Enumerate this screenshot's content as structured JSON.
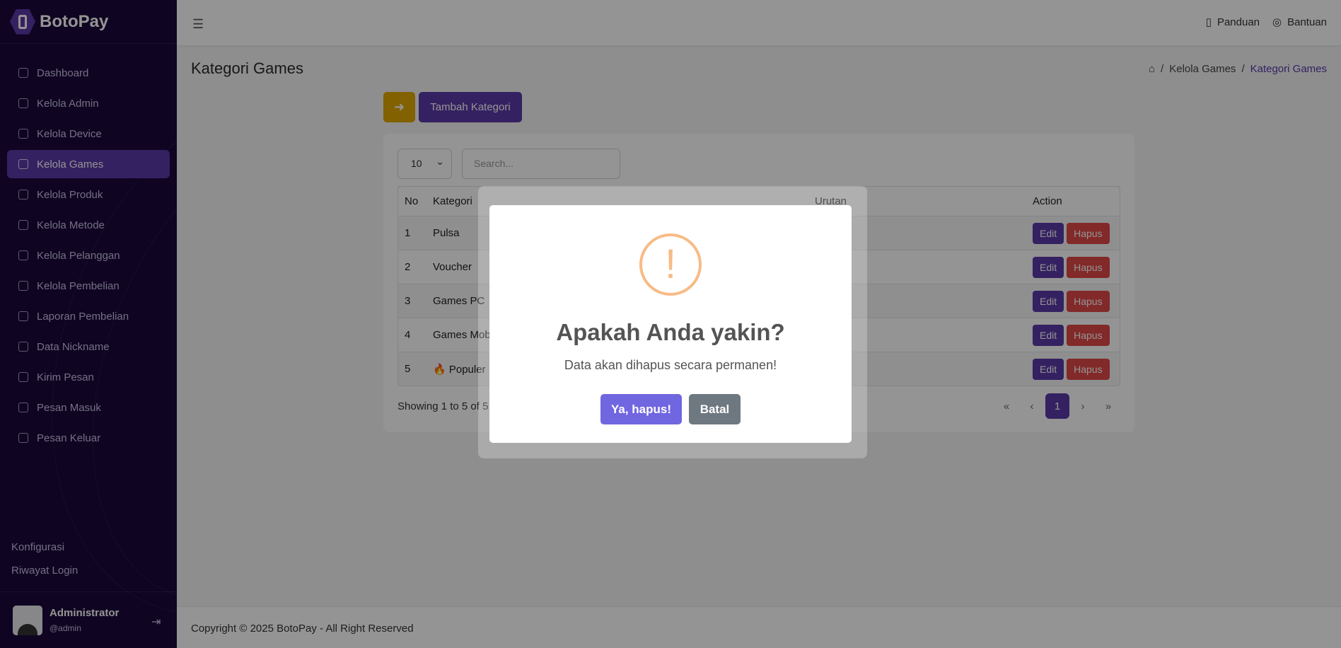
{
  "brand": {
    "name": "BotoPay"
  },
  "sidebar": {
    "items": [
      {
        "label": "Dashboard",
        "icon": "home-icon"
      },
      {
        "label": "Kelola Admin",
        "icon": "user-icon"
      },
      {
        "label": "Kelola Device",
        "icon": "device-icon"
      },
      {
        "label": "Kelola Games",
        "icon": "gamepad-icon"
      },
      {
        "label": "Kelola Produk",
        "icon": "box-icon"
      },
      {
        "label": "Kelola Metode",
        "icon": "card-icon"
      },
      {
        "label": "Kelola Pelanggan",
        "icon": "users-icon"
      },
      {
        "label": "Kelola Pembelian",
        "icon": "cart-icon"
      },
      {
        "label": "Laporan Pembelian",
        "icon": "report-icon"
      },
      {
        "label": "Data Nickname",
        "icon": "id-icon"
      },
      {
        "label": "Kirim Pesan",
        "icon": "send-icon"
      },
      {
        "label": "Pesan Masuk",
        "icon": "inbox-icon"
      },
      {
        "label": "Pesan Keluar",
        "icon": "outbox-icon"
      }
    ],
    "bottom": {
      "config": "Konfigurasi",
      "login_history": "Riwayat Login"
    },
    "user": {
      "name": "Administrator",
      "handle": "@admin"
    }
  },
  "topbar": {
    "guide": "Panduan",
    "help": "Bantuan"
  },
  "page": {
    "title": "Kategori Games",
    "breadcrumb": [
      "Kelola Games",
      "Kategori Games"
    ],
    "add_button": "Tambah Kategori"
  },
  "table": {
    "page_size": "10",
    "search_placeholder": "Search...",
    "headers": {
      "no": "No",
      "kategori": "Kategori",
      "urutan": "Urutan",
      "action": "Action"
    },
    "rows": [
      {
        "no": "1",
        "kategori": "Pulsa"
      },
      {
        "no": "2",
        "kategori": "Voucher"
      },
      {
        "no": "3",
        "kategori": "Games PC"
      },
      {
        "no": "4",
        "kategori": "Games Mobile"
      },
      {
        "no": "5",
        "kategori": "🔥 Populer"
      }
    ],
    "edit_label": "Edit",
    "delete_label": "Hapus",
    "showing": "Showing 1 to 5 of 5 entries",
    "pager": {
      "first": "«",
      "prev": "‹",
      "current": "1",
      "next": "›",
      "last": "»"
    }
  },
  "footer": {
    "copyright": "Copyright © 2025 BotoPay - All Right Reserved"
  },
  "modal": {
    "icon": "!",
    "title": "Apakah Anda yakin?",
    "text": "Data akan dihapus secara permanen!",
    "confirm": "Ya, hapus!",
    "cancel": "Batal"
  },
  "colors": {
    "accent": "#5b3aa8",
    "sidebar_bg": "#1a0a3b",
    "danger": "#e04848",
    "warning": "#e0a800",
    "modal_confirm": "#7066e0"
  }
}
